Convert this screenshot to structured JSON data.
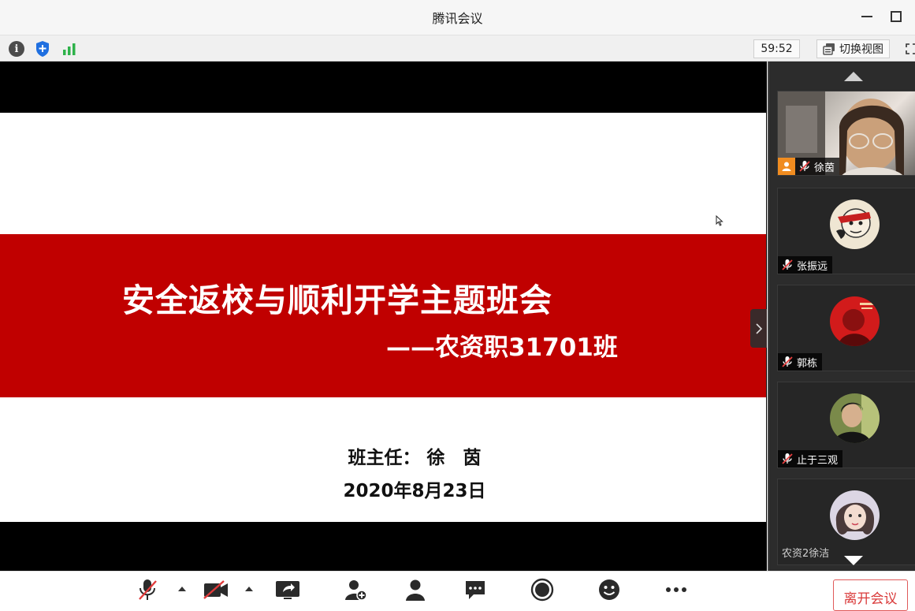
{
  "window": {
    "title": "腾讯会议"
  },
  "toolbar": {
    "timer": "59:52",
    "switch_view_label": "切换视图"
  },
  "slide": {
    "title": "安全返校与顺利开学主题班会",
    "subtitle": "——农资职31701班",
    "teacher": "班主任： 徐　茵",
    "date": "2020年8月23日",
    "colors": {
      "band": "#c00000",
      "background": "#ffffff"
    }
  },
  "participants": [
    {
      "name": "徐茵",
      "video": true,
      "muted": true
    },
    {
      "name": "张振远",
      "video": false,
      "muted": true
    },
    {
      "name": "郭栋",
      "video": false,
      "muted": true
    },
    {
      "name": "止于三观",
      "video": false,
      "muted": true
    },
    {
      "name": "农资2徐洁",
      "video": false,
      "muted": false
    }
  ],
  "bottombar": {
    "leave_label": "离开会议"
  },
  "icons": [
    "info-icon",
    "shield-icon",
    "signal-icon",
    "switch-view-icon",
    "fullscreen-icon",
    "mic-muted-icon",
    "camera-off-icon",
    "share-screen-icon",
    "invite-icon",
    "participants-icon",
    "chat-icon",
    "record-icon",
    "reaction-icon",
    "more-icon"
  ]
}
